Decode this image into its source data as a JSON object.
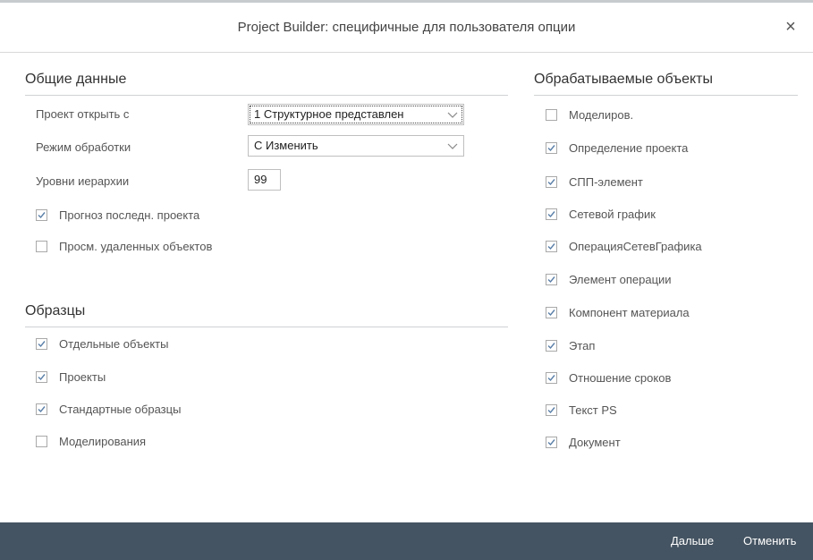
{
  "dialog": {
    "title": "Project Builder: специфичные для пользователя опции",
    "close_glyph": "×"
  },
  "general": {
    "title": "Общие данные",
    "open_project_label": "Проект открыть с",
    "open_project_value": "1 Структурное представлен",
    "processing_mode_label": "Режим обработки",
    "processing_mode_value": "С Изменить",
    "hierarchy_levels_label": "Уровни иерархии",
    "hierarchy_levels_value": "99",
    "checkboxes": [
      {
        "label": "Прогноз последн. проекта",
        "checked": true
      },
      {
        "label": "Просм. удаленных объектов",
        "checked": false
      }
    ]
  },
  "templates": {
    "title": "Образцы",
    "checkboxes": [
      {
        "label": "Отдельные объекты",
        "checked": true
      },
      {
        "label": "Проекты",
        "checked": true
      },
      {
        "label": "Стандартные образцы",
        "checked": true
      },
      {
        "label": "Моделирования",
        "checked": false
      }
    ]
  },
  "processed_objects": {
    "title": "Обрабатываемые объекты",
    "checkboxes": [
      {
        "label": "Моделиров.",
        "checked": false
      },
      {
        "label": "Определение проекта",
        "checked": true
      },
      {
        "label": "СПП-элемент",
        "checked": true
      },
      {
        "label": "Сетевой график",
        "checked": true
      },
      {
        "label": "ОперацияСетевГрафика",
        "checked": true
      },
      {
        "label": "Элемент операции",
        "checked": true
      },
      {
        "label": "Компонент материала",
        "checked": true
      },
      {
        "label": "Этап",
        "checked": true
      },
      {
        "label": "Отношение сроков",
        "checked": true
      },
      {
        "label": "Текст PS",
        "checked": true
      },
      {
        "label": "Документ",
        "checked": true
      }
    ]
  },
  "footer": {
    "next_label": "Дальше",
    "cancel_label": "Отменить"
  },
  "colors": {
    "footer_bg": "#455462",
    "check_mark": "#5a7fa8"
  }
}
